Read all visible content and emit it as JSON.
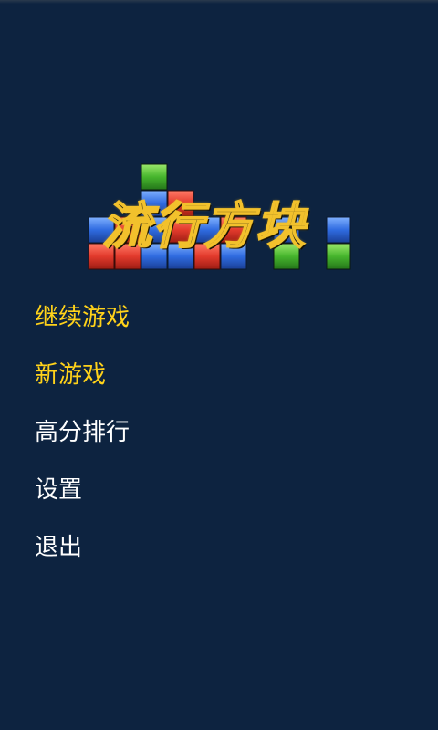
{
  "logo": {
    "title": "流行方块",
    "block_colors": {
      "red": "#e23a2c",
      "blue": "#2f6be0",
      "green": "#46b52d"
    }
  },
  "menu": {
    "items": [
      {
        "label": "继续游戏",
        "highlight": true
      },
      {
        "label": "新游戏",
        "highlight": true
      },
      {
        "label": "高分排行",
        "highlight": false
      },
      {
        "label": "设置",
        "highlight": false
      },
      {
        "label": "退出",
        "highlight": false
      }
    ],
    "highlight_color": "#ffd21a",
    "default_color": "#ffffff"
  },
  "background_color": "#0d2340"
}
